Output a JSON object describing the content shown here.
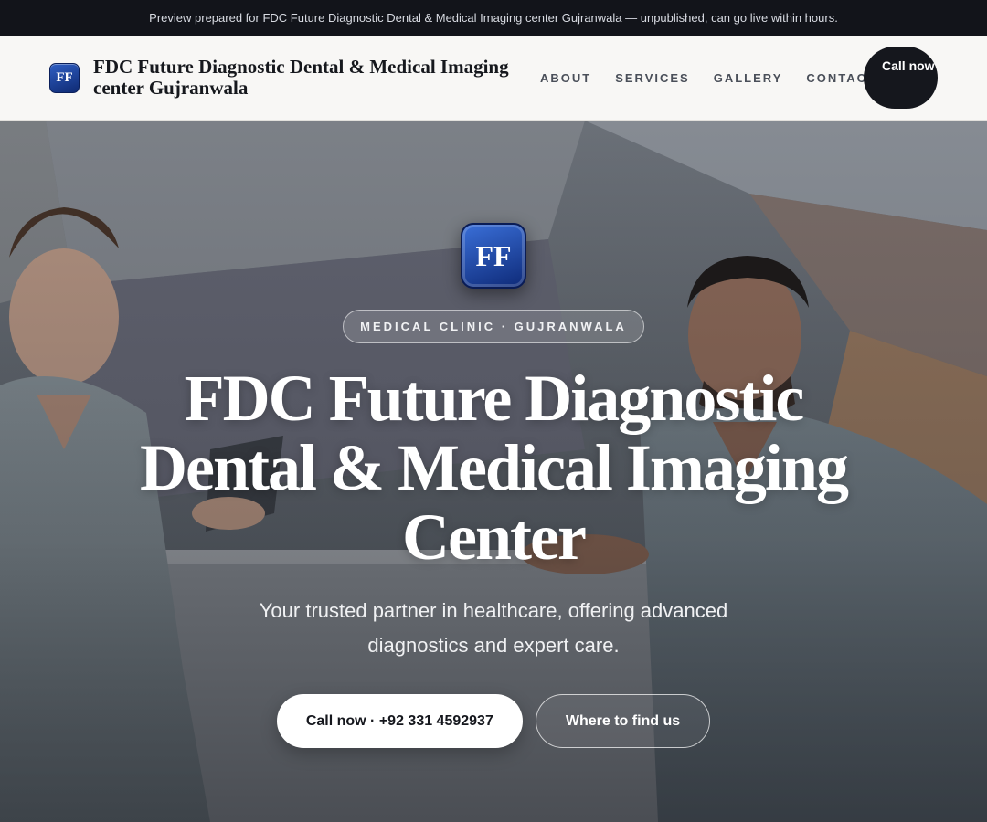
{
  "topbar": {
    "text": "Preview prepared for FDC Future Diagnostic Dental & Medical Imaging center Gujranwala — unpublished, can go live within hours."
  },
  "nav": {
    "logo_text": "FF",
    "brand": "FDC Future Diagnostic Dental & Medical Imaging center Gujranwala",
    "links": [
      "ABOUT",
      "SERVICES",
      "GALLERY",
      "CONTACT"
    ],
    "call_label": "Call now"
  },
  "hero": {
    "logo_text": "FF",
    "pill": "MEDICAL CLINIC · GUJRANWALA",
    "title": "FDC Future Diagnostic Dental & Medical Imaging Center",
    "subtitle": "Your trusted partner in healthcare, offering advanced diagnostics and expert care.",
    "primary_button": "Call now · +92 331 4592937",
    "secondary_button": "Where to find us"
  },
  "colors": {
    "topbar_bg": "#12141a",
    "nav_bg": "#f8f7f5",
    "logo_blue": "#1e47a8",
    "call_button_bg": "#15171d"
  }
}
